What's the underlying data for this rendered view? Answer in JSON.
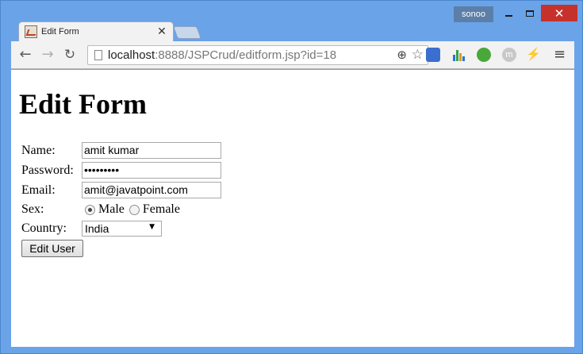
{
  "window": {
    "user_badge": "sonoo",
    "close_glyph": "✕"
  },
  "tab": {
    "title": "Edit Form",
    "close_glyph": "✕"
  },
  "toolbar": {
    "url_host": "localhost",
    "url_rest": ":8888/JSPCrud/editform.jsp?id=18",
    "back_glyph": "←",
    "forward_glyph": "→",
    "reload_glyph": "↻",
    "zoom_glyph": "⊕",
    "star_glyph": "☆",
    "menu_glyph": "≡",
    "ext_m_label": "m"
  },
  "page": {
    "title": "Edit Form"
  },
  "form": {
    "name_label": "Name:",
    "name_value": "amit kumar",
    "password_label": "Password:",
    "password_value": "•••••••••",
    "email_label": "Email:",
    "email_value": "amit@javatpoint.com",
    "sex_label": "Sex:",
    "sex_options": [
      "Male",
      "Female"
    ],
    "sex_selected": "Male",
    "country_label": "Country:",
    "country_value": "India",
    "submit_label": "Edit User"
  }
}
